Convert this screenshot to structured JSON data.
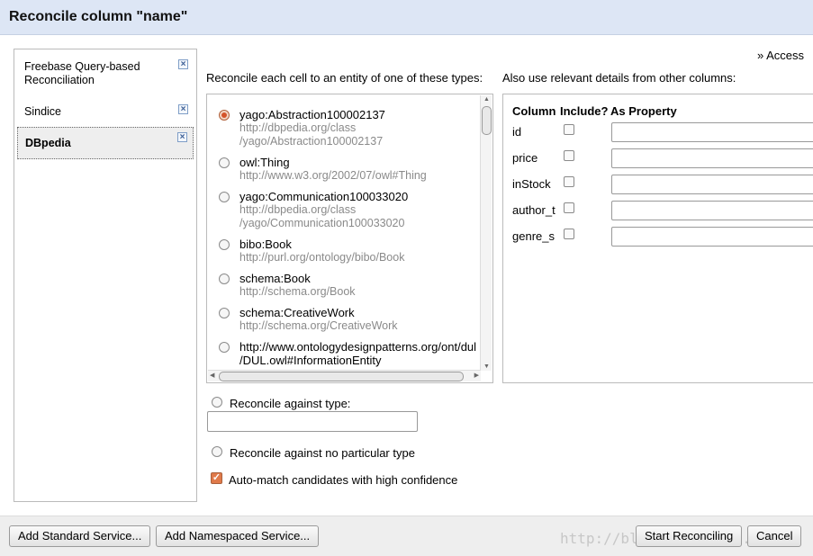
{
  "dialog": {
    "title": "Reconcile column \"name\""
  },
  "access_link": "» Access",
  "services": [
    {
      "label": "Freebase Query-based Reconciliation",
      "close": "×",
      "selected": false
    },
    {
      "label": "Sindice",
      "close": "×",
      "selected": false
    },
    {
      "label": "DBpedia",
      "close": "×",
      "selected": true
    }
  ],
  "types_label": "Reconcile each cell to an entity of one of these types:",
  "types": [
    {
      "name": "yago:Abstraction100002137",
      "url_lines": [
        "http://dbpedia.org/class",
        "/yago/Abstraction100002137"
      ],
      "checked": true
    },
    {
      "name": "owl:Thing",
      "url_lines": [
        "http://www.w3.org/2002/07/owl#Thing"
      ],
      "checked": false
    },
    {
      "name": "yago:Communication100033020",
      "url_lines": [
        "http://dbpedia.org/class",
        "/yago/Communication100033020"
      ],
      "checked": false
    },
    {
      "name": "bibo:Book",
      "url_lines": [
        "http://purl.org/ontology/bibo/Book"
      ],
      "checked": false
    },
    {
      "name": "schema:Book",
      "url_lines": [
        "http://schema.org/Book"
      ],
      "checked": false
    },
    {
      "name": "schema:CreativeWork",
      "url_lines": [
        "http://schema.org/CreativeWork"
      ],
      "checked": false
    },
    {
      "name_lines": [
        "http://www.ontologydesignpatterns.org/ont/dul",
        "/DUL.owl#InformationEntity"
      ],
      "checked": false
    }
  ],
  "columns_label": "Also use relevant details from other columns:",
  "columns_table": {
    "headers": [
      "Column",
      "Include?",
      "As Property"
    ],
    "rows": [
      {
        "column": "id",
        "include": false,
        "property": ""
      },
      {
        "column": "price",
        "include": false,
        "property": ""
      },
      {
        "column": "inStock",
        "include": false,
        "property": ""
      },
      {
        "column": "author_t",
        "include": false,
        "property": ""
      },
      {
        "column": "genre_s",
        "include": false,
        "property": ""
      }
    ]
  },
  "options": {
    "against_type_label": "Reconcile against type:",
    "against_type_value": "",
    "no_type_label": "Reconcile against no particular type",
    "automatch_label": "Auto-match candidates with high confidence",
    "automatch_checked": true
  },
  "buttons": {
    "add_standard": "Add Standard Service...",
    "add_namespaced": "Add Namespaced Service...",
    "start": "Start Reconciling",
    "cancel": "Cancel"
  },
  "watermark": "http://blog.csdn.net/..."
}
